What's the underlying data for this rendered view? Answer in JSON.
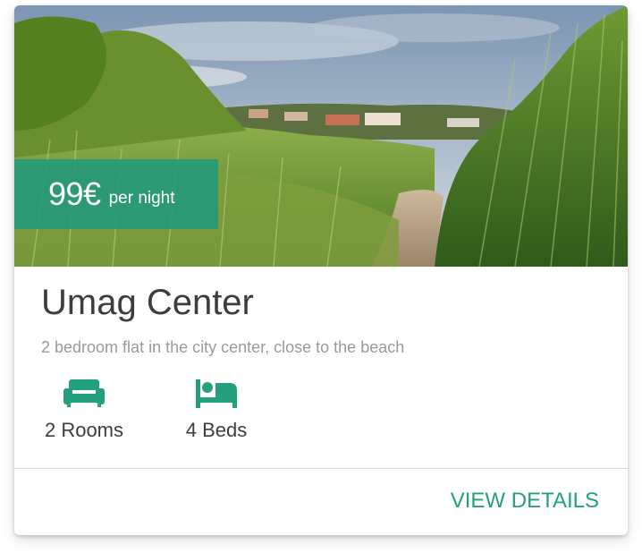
{
  "listing": {
    "price": {
      "amount": "99€",
      "unit": "per night"
    },
    "title": "Umag Center",
    "description": "2 bedroom flat in the city center, close to the beach",
    "features": [
      {
        "icon": "sofa-icon",
        "label": "2 Rooms"
      },
      {
        "icon": "bed-icon",
        "label": "4 Beds"
      }
    ],
    "action_label": "VIEW DETAILS"
  },
  "colors": {
    "accent": "#25a07e",
    "badge_background": "#24997b",
    "title_text": "#3d3d3d",
    "subtitle_text": "#9a9a9a",
    "divider": "#dcdcdc"
  }
}
